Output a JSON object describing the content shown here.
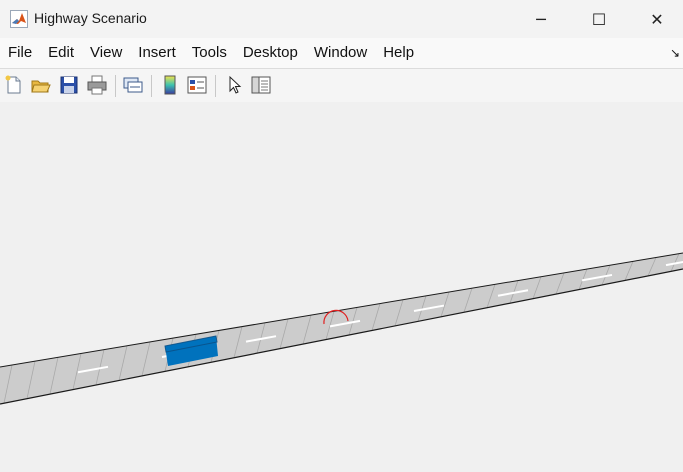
{
  "window": {
    "title": "Highway Scenario",
    "controls": {
      "minimize": "─",
      "maximize": "☐",
      "close": "✕"
    }
  },
  "menubar": {
    "items": [
      {
        "label": "File"
      },
      {
        "label": "Edit"
      },
      {
        "label": "View"
      },
      {
        "label": "Insert"
      },
      {
        "label": "Tools"
      },
      {
        "label": "Desktop"
      },
      {
        "label": "Window"
      },
      {
        "label": "Help"
      }
    ],
    "overflow_arrow": "↘"
  },
  "toolbar": {
    "buttons": [
      {
        "icon": "new-figure-icon"
      },
      {
        "icon": "open-file-icon"
      },
      {
        "icon": "save-icon"
      },
      {
        "icon": "print-icon"
      },
      {
        "icon": "link-plot-icon"
      },
      {
        "icon": "insert-colorbar-icon"
      },
      {
        "icon": "insert-legend-icon"
      },
      {
        "icon": "edit-plot-icon"
      },
      {
        "icon": "open-property-inspector-icon"
      }
    ]
  },
  "scene": {
    "road_color": "#cccccc",
    "road_edge_color": "#1a1a1a",
    "lane_marking_color": "#ffffff",
    "vehicle_color": "#0072bd",
    "waypoint_marker_color": "#e02020"
  }
}
